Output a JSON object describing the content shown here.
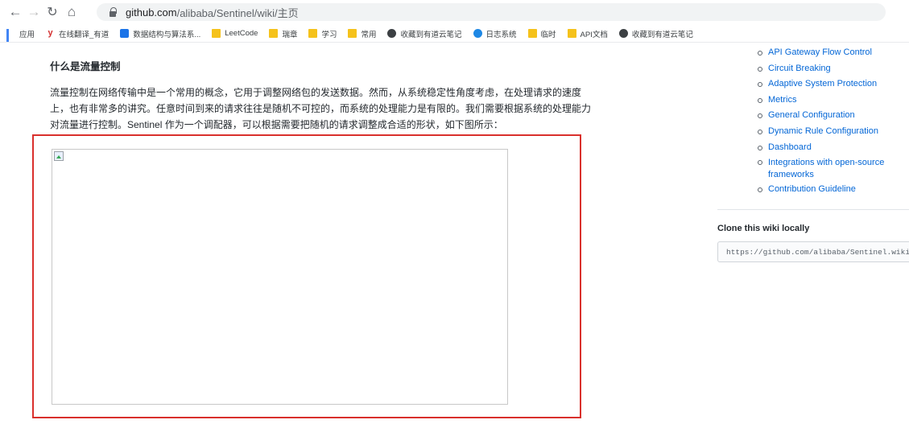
{
  "browser": {
    "url_host": "github.com",
    "url_path": "/alibaba/Sentinel/wiki/主页"
  },
  "bookmarks": [
    {
      "label": "应用",
      "icon": "apps-icon"
    },
    {
      "label": "在线翻译_有道",
      "icon": "youdao-icon"
    },
    {
      "label": "数据结构与算法系...",
      "icon": "blue-app-icon"
    },
    {
      "label": "LeetCode",
      "icon": "folder-icon"
    },
    {
      "label": "瑞章",
      "icon": "folder-icon"
    },
    {
      "label": "学习",
      "icon": "folder-icon"
    },
    {
      "label": "常用",
      "icon": "folder-icon"
    },
    {
      "label": "收藏到有道云笔记",
      "icon": "globe-icon"
    },
    {
      "label": "日志系统",
      "icon": "globe-blue-icon"
    },
    {
      "label": "临时",
      "icon": "folder-icon"
    },
    {
      "label": "API文档",
      "icon": "folder-icon"
    },
    {
      "label": "收藏到有道云笔记",
      "icon": "globe-icon"
    }
  ],
  "article": {
    "heading": "什么是流量控制",
    "paragraph_lines": [
      "流量控制在网络传输中是一个常用的概念，它用于调整网络包的发送数据。然而，从系统稳定性角度考虑，在处理请求的速度",
      "上，也有非常多的讲究。任意时间到来的请求往往是随机不可控的，而系统的处理能力是有限的。我们需要根据系统的处理能力",
      "对流量进行控制。Sentinel 作为一个调配器，可以根据需要把随机的请求调整成合适的形状，如下图所示："
    ]
  },
  "sidebar": {
    "toc": [
      "API Gateway Flow Control",
      "Circuit Breaking",
      "Adaptive System Protection",
      "Metrics",
      "General Configuration",
      "Dynamic Rule Configuration",
      "Dashboard",
      "Integrations with open-source frameworks",
      "Contribution Guideline"
    ],
    "clone_title": "Clone this wiki locally",
    "clone_url": "https://github.com/alibaba/Sentinel.wiki.git"
  },
  "colors": {
    "highlight": "#d9302c",
    "link": "#0366d6"
  }
}
